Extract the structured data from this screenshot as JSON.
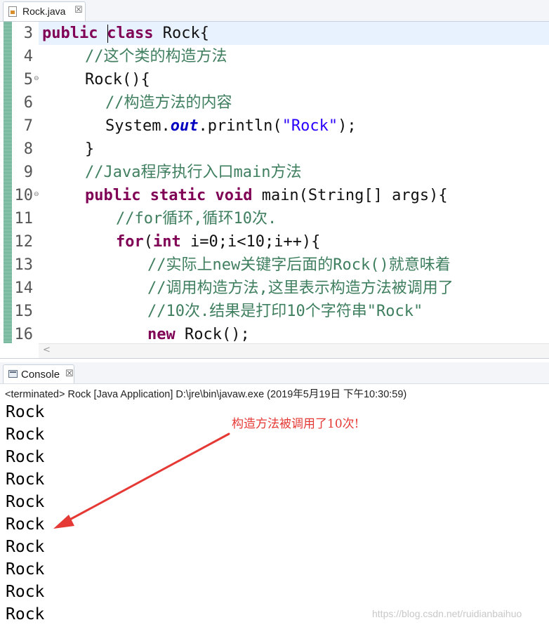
{
  "editor": {
    "tab": {
      "label": "Rock.java",
      "close": "☒"
    },
    "lines": [
      {
        "num": "3",
        "fold": ""
      },
      {
        "num": "4",
        "fold": ""
      },
      {
        "num": "5",
        "fold": "⊖"
      },
      {
        "num": "6",
        "fold": ""
      },
      {
        "num": "7",
        "fold": ""
      },
      {
        "num": "8",
        "fold": ""
      },
      {
        "num": "9",
        "fold": ""
      },
      {
        "num": "10",
        "fold": "⊖"
      },
      {
        "num": "11",
        "fold": ""
      },
      {
        "num": "12",
        "fold": ""
      },
      {
        "num": "13",
        "fold": ""
      },
      {
        "num": "14",
        "fold": ""
      },
      {
        "num": "15",
        "fold": ""
      },
      {
        "num": "16",
        "fold": ""
      }
    ],
    "code": {
      "l3_kw": "public",
      "l3_class": "class",
      "l3_rest": " Rock{",
      "l4": "//这个类的构造方法",
      "l5": "Rock(){",
      "l6": "//构造方法的内容",
      "l7_a": "System.",
      "l7_out": "out",
      "l7_b": ".println(",
      "l7_str": "\"Rock\"",
      "l7_c": ");",
      "l8": "}",
      "l9": "//Java程序执行入口main方法",
      "l10_public": "public",
      "l10_static": "static",
      "l10_void": "void",
      "l10_rest": " main(String[] args){",
      "l11": "//for循环,循环10次.",
      "l12_for": "for",
      "l12_a": "(",
      "l12_int": "int",
      "l12_b": " i=0;i<10;i++){",
      "l13": "//实际上new关键字后面的Rock()就意味着",
      "l14": "//调用构造方法,这里表示构造方法被调用了",
      "l15": "//10次.结果是打印10个字符串\"Rock\"",
      "l16_new": "new",
      "l16_rest": " Rock();"
    },
    "scroll_arrow": "<"
  },
  "console": {
    "tab": {
      "label": "Console",
      "close": "☒"
    },
    "status": "<terminated> Rock [Java Application] D:\\jre\\bin\\javaw.exe (2019年5月19日 下午10:30:59)",
    "output": [
      "Rock",
      "Rock",
      "Rock",
      "Rock",
      "Rock",
      "Rock",
      "Rock",
      "Rock",
      "Rock",
      "Rock"
    ]
  },
  "annotation": {
    "text": "构造方法被调用了10次!",
    "color": "#e53935"
  },
  "watermark": "https://blog.csdn.net/ruidianbaihuo"
}
